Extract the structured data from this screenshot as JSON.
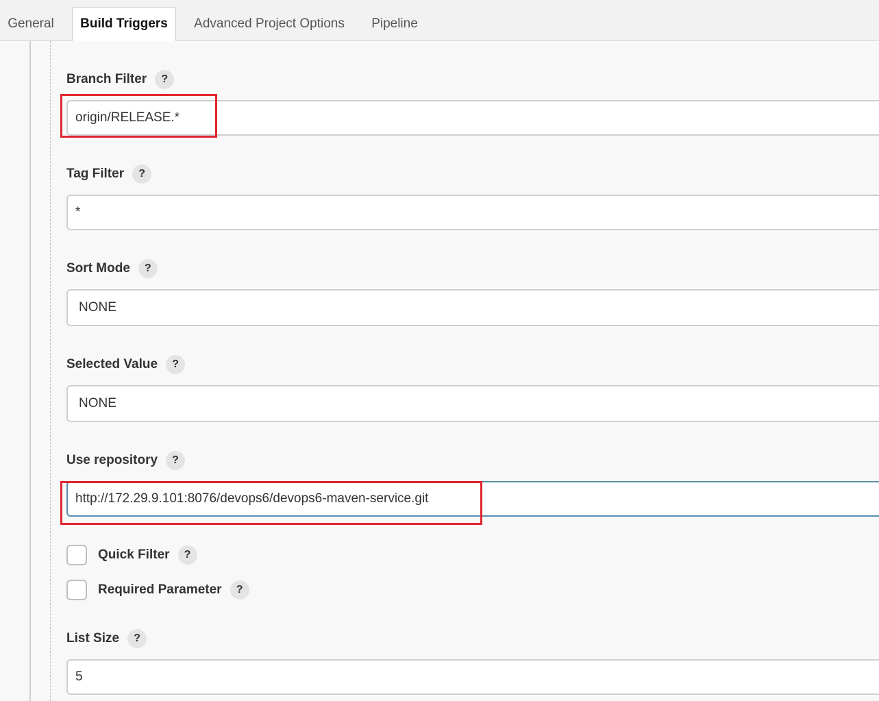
{
  "tabs": [
    {
      "label": "General"
    },
    {
      "label": "Build Triggers"
    },
    {
      "label": "Advanced Project Options"
    },
    {
      "label": "Pipeline"
    }
  ],
  "help_glyph": "?",
  "fields": {
    "branch_filter": {
      "label": "Branch Filter",
      "value": "origin/RELEASE.*"
    },
    "tag_filter": {
      "label": "Tag Filter",
      "value": "*"
    },
    "sort_mode": {
      "label": "Sort Mode",
      "value": "NONE"
    },
    "selected_value": {
      "label": "Selected Value",
      "value": "NONE"
    },
    "use_repository": {
      "label": "Use repository",
      "value": "http://172.29.9.101:8076/devops6/devops6-maven-service.git"
    },
    "quick_filter": {
      "label": "Quick Filter",
      "checked": false
    },
    "required_parameter": {
      "label": "Required Parameter",
      "checked": false
    },
    "list_size": {
      "label": "List Size",
      "value": "5"
    }
  },
  "colors": {
    "highlight": "#e0262f",
    "active_tab_bg": "#ffffff",
    "focus_border": "#5a8fb0"
  }
}
